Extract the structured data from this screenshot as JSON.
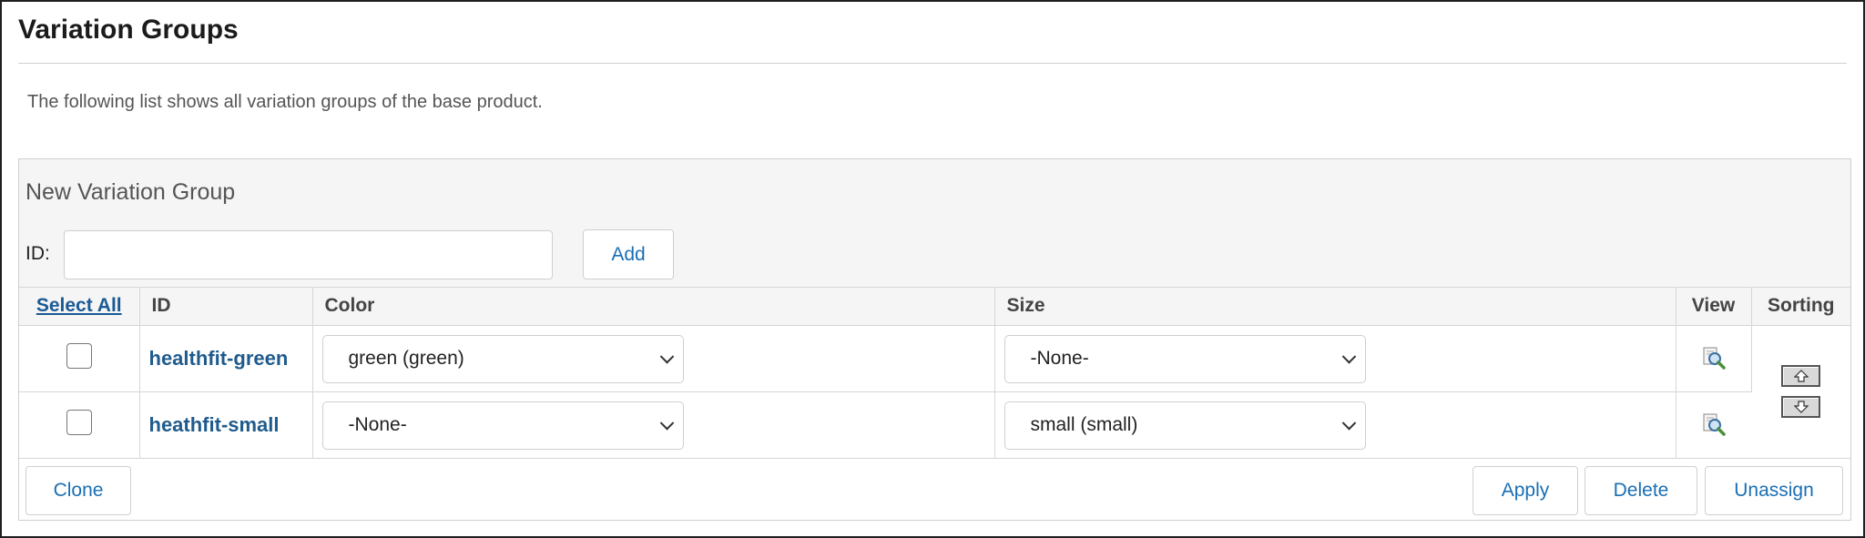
{
  "page": {
    "title": "Variation Groups",
    "description": "The following list shows all variation groups of the base product."
  },
  "new_group": {
    "title": "New Variation Group",
    "id_label": "ID:",
    "id_value": "",
    "add_label": "Add"
  },
  "table": {
    "headers": {
      "select_all": "Select All",
      "id": "ID",
      "color": "Color",
      "size": "Size",
      "view": "View",
      "sorting": "Sorting"
    },
    "rows": [
      {
        "id": "healthfit-green",
        "color": "green (green)",
        "size": "-None-",
        "checked": false
      },
      {
        "id": "heathfit-small",
        "color": "-None-",
        "size": "small (small)",
        "checked": false
      }
    ]
  },
  "footer": {
    "clone_label": "Clone",
    "apply_label": "Apply",
    "delete_label": "Delete",
    "unassign_label": "Unassign"
  },
  "icons": {
    "view": "magnifier-document-icon",
    "sort_up": "arrow-up-icon",
    "sort_down": "arrow-down-icon",
    "dropdown": "chevron-down-icon"
  },
  "colors": {
    "link": "#1f5b8c",
    "button_text": "#1a6fb4",
    "panel_bg": "#f5f5f5",
    "border": "#cfcfcf"
  }
}
